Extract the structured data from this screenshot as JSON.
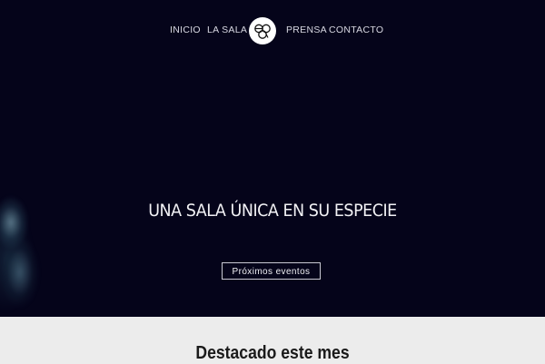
{
  "nav": {
    "items": [
      {
        "label": "INICIO"
      },
      {
        "label": "LA SALA"
      },
      {
        "label": "PRENSA"
      },
      {
        "label": "CONTACTO"
      }
    ],
    "logo_text": "ego"
  },
  "hero": {
    "title": "UNA SALA ÚNICA EN SU ESPECIE",
    "cta_label": "Próximos eventos"
  },
  "featured": {
    "title": "Destacado este mes"
  },
  "colors": {
    "hero_background": "#05041a",
    "section_background": "#ececec",
    "nav_text": "#d8d8e2",
    "logo_background": "#ffffff"
  }
}
